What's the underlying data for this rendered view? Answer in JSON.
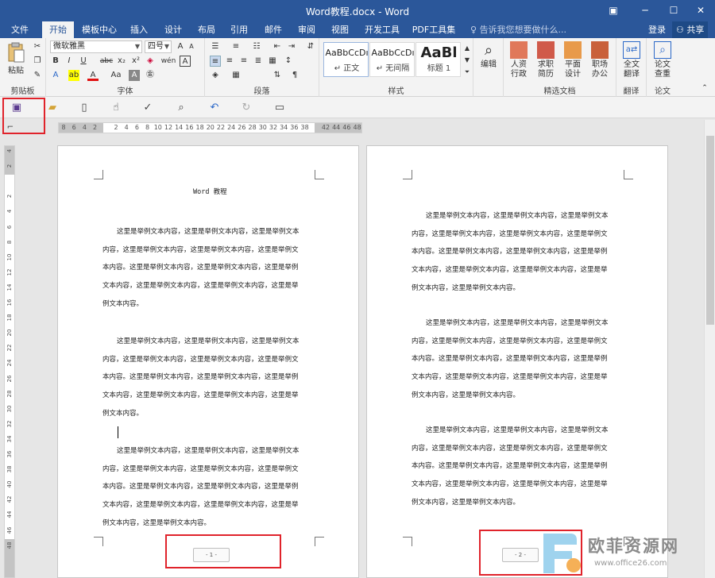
{
  "window": {
    "title": "Word教程.docx - Word",
    "controls": [
      "▣",
      "─",
      "☐",
      "✕"
    ]
  },
  "tabs": [
    "文件",
    "开始",
    "模板中心",
    "插入",
    "设计",
    "布局",
    "引用",
    "邮件",
    "审阅",
    "视图",
    "开发工具",
    "PDF工具集"
  ],
  "active_tab": "开始",
  "tell_me": "告诉我您想要做什么...",
  "account": {
    "login": "登录",
    "share": "共享"
  },
  "ribbon": {
    "clipboard": {
      "label": "剪贴板",
      "paste": "粘贴"
    },
    "font": {
      "label": "字体",
      "name": "微软雅黑",
      "size": "四号",
      "bold": "B",
      "italic": "I",
      "underline": "U",
      "strike": "abc",
      "sub": "x₂",
      "sup": "x²",
      "grow": "A",
      "shrink": "A",
      "color_a": "A",
      "char_a": "A",
      "aa": "Aa",
      "phonetic": "wén",
      "char_border": "A"
    },
    "paragraph": {
      "label": "段落"
    },
    "styles": {
      "label": "样式",
      "items": [
        {
          "preview": "AaBbCcDı",
          "name": "↵ 正文"
        },
        {
          "preview": "AaBbCcDı",
          "name": "↵ 无间隔"
        },
        {
          "preview": "AaBl",
          "name": "标题 1"
        }
      ]
    },
    "editing": {
      "label": "编辑"
    },
    "docs": {
      "label": "精选文档",
      "items": [
        "人资行政",
        "求职简历",
        "平面设计",
        "职场办公"
      ]
    },
    "translate": {
      "label": "翻译",
      "item": "全文翻译"
    },
    "paper": {
      "label": "论文",
      "item": "论文查重"
    }
  },
  "ruler": {
    "h_labels": [
      "8",
      "6",
      "4",
      "2",
      "",
      "2",
      "4",
      "6",
      "8",
      "10",
      "12",
      "14",
      "16",
      "18",
      "20",
      "22",
      "24",
      "26",
      "28",
      "30",
      "32",
      "34",
      "36",
      "38",
      "",
      "42",
      "44",
      "46",
      "48"
    ],
    "v_labels": [
      "4",
      "2",
      "",
      "2",
      "4",
      "6",
      "8",
      "10",
      "12",
      "14",
      "16",
      "18",
      "20",
      "22",
      "24",
      "26",
      "28",
      "30",
      "32",
      "34",
      "36",
      "38",
      "40",
      "42",
      "44",
      "46",
      "48"
    ]
  },
  "page1": {
    "title": "Word 教程",
    "paragraphs": [
      [
        "这里是举例文本内容，这里是举例文本内容，这里是举例文本",
        "内容，这里是举例文本内容，这里是举例文本内容，这里是举例文",
        "本内容。这里是举例文本内容，这里是举例文本内容，这里是举例",
        "文本内容，这里是举例文本内容，这里是举例文本内容，这里是举",
        "例文本内容。"
      ],
      [
        "这里是举例文本内容，这里是举例文本内容，这里是举例文本",
        "内容，这里是举例文本内容，这里是举例文本内容，这里是举例文",
        "本内容。这里是举例文本内容，这里是举例文本内容，这里是举例",
        "文本内容，这里是举例文本内容，这里是举例文本内容，这里是举",
        "例文本内容。"
      ],
      [
        "这里是举例文本内容，这里是举例文本内容，这里是举例文本",
        "内容，这里是举例文本内容，这里是举例文本内容，这里是举例文",
        "本内容。这里是举例文本内容，这里是举例文本内容，这里是举例",
        "文本内容，这里是举例文本内容，这里是举例文本内容，这里是举",
        "例文本内容，这里是举例文本内容。"
      ]
    ],
    "page_number": "- 1 -"
  },
  "page2": {
    "paragraphs": [
      [
        "这里是举例文本内容，这里是举例文本内容，这里是举例文本",
        "内容，这里是举例文本内容，这里是举例文本内容，这里是举例文",
        "本内容。这里是举例文本内容，这里是举例文本内容，这里是举例",
        "文本内容，这里是举例文本内容，这里是举例文本内容，这里是举",
        "例文本内容，这里是举例文本内容。"
      ],
      [
        "这里是举例文本内容，这里是举例文本内容，这里是举例文本",
        "内容，这里是举例文本内容，这里是举例文本内容，这里是举例文",
        "本内容。这里是举例文本内容，这里是举例文本内容，这里是举例",
        "文本内容，这里是举例文本内容，这里是举例文本内容，这里是举",
        "例文本内容，这里是举例文本内容。"
      ],
      [
        "这里是举例文本内容，这里是举例文本内容，这里是举例文本",
        "内容，这里是举例文本内容，这里是举例文本内容，这里是举例文",
        "本内容。这里是举例文本内容，这里是举例文本内容，这里是举例",
        "文本内容，这里是举例文本内容，这里是举例文本内容，这里是举",
        "例文本内容，这里是举例文本内容。"
      ]
    ],
    "page_number": "- 2 -"
  },
  "watermark": {
    "brand": "欧菲资源网",
    "url": "www.office26.com"
  },
  "colors": {
    "title_blue": "#2b579a",
    "highlight_red": "#e0232b"
  }
}
